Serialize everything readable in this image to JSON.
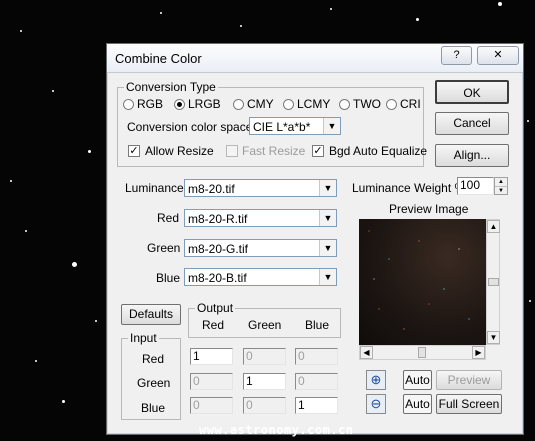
{
  "window": {
    "title": "Combine Color",
    "help_label": "?",
    "close_label": "✕"
  },
  "conversion": {
    "group_label": "Conversion Type",
    "options": [
      "RGB",
      "LRGB",
      "CMY",
      "LCMY",
      "TWO",
      "CRI"
    ],
    "selected": "LRGB",
    "colorspace_label": "Conversion color space",
    "colorspace_value": "CIE L*a*b*",
    "allow_resize": {
      "label": "Allow Resize",
      "checked": true
    },
    "fast_resize": {
      "label": "Fast Resize",
      "checked": false,
      "enabled": false
    },
    "bgd_equalize": {
      "label": "Bgd Auto Equalize",
      "checked": true
    }
  },
  "buttons": {
    "ok": "OK",
    "cancel": "Cancel",
    "align": "Align...",
    "defaults": "Defaults",
    "auto1": "Auto",
    "preview": "Preview",
    "auto2": "Auto",
    "fullscreen": "Full Screen"
  },
  "channels": [
    {
      "label": "Luminance",
      "file": "m8-20.tif"
    },
    {
      "label": "Red",
      "file": "m8-20-R.tif"
    },
    {
      "label": "Green",
      "file": "m8-20-G.tif"
    },
    {
      "label": "Blue",
      "file": "m8-20-B.tif"
    }
  ],
  "luminance_weight": {
    "label": "Luminance Weight %",
    "value": "100"
  },
  "preview_label": "Preview Image",
  "output_group": {
    "label": "Output",
    "columns": [
      "Red",
      "Green",
      "Blue"
    ]
  },
  "input_group": {
    "label": "Input",
    "rows": [
      {
        "label": "Red",
        "values": [
          "1",
          "0",
          "0"
        ]
      },
      {
        "label": "Green",
        "values": [
          "0",
          "1",
          "0"
        ]
      },
      {
        "label": "Blue",
        "values": [
          "0",
          "0",
          "1"
        ]
      }
    ]
  },
  "watermark": "www.astronomy.com.cn",
  "colors": {
    "dialog_bg": "#f0f0f0",
    "background": "#050505"
  }
}
